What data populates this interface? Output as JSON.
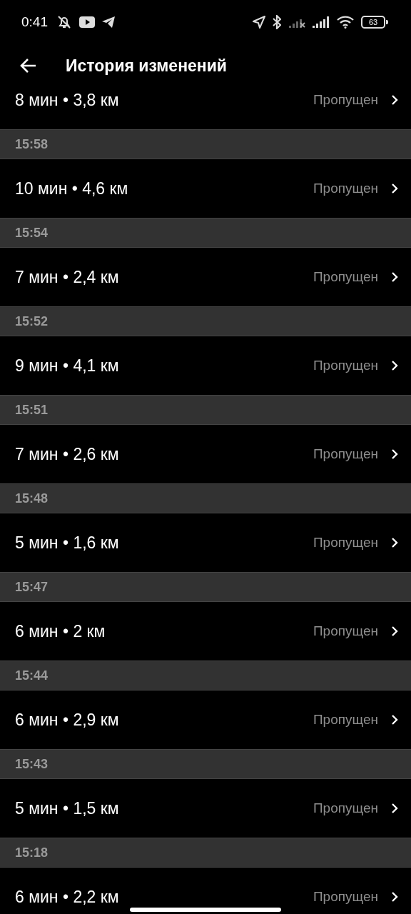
{
  "status_bar": {
    "time": "0:41",
    "battery": "63"
  },
  "app_bar": {
    "title": "История изменений"
  },
  "list": [
    {
      "kind": "row",
      "text": "8 мин • 3,8 км",
      "status": "Пропущен"
    },
    {
      "kind": "header",
      "time": "15:58"
    },
    {
      "kind": "row",
      "text": "10 мин • 4,6 км",
      "status": "Пропущен"
    },
    {
      "kind": "header",
      "time": "15:54"
    },
    {
      "kind": "row",
      "text": "7 мин • 2,4 км",
      "status": "Пропущен"
    },
    {
      "kind": "header",
      "time": "15:52"
    },
    {
      "kind": "row",
      "text": "9 мин • 4,1 км",
      "status": "Пропущен"
    },
    {
      "kind": "header",
      "time": "15:51"
    },
    {
      "kind": "row",
      "text": "7 мин • 2,6 км",
      "status": "Пропущен"
    },
    {
      "kind": "header",
      "time": "15:48"
    },
    {
      "kind": "row",
      "text": "5 мин • 1,6 км",
      "status": "Пропущен"
    },
    {
      "kind": "header",
      "time": "15:47"
    },
    {
      "kind": "row",
      "text": "6 мин • 2 км",
      "status": "Пропущен"
    },
    {
      "kind": "header",
      "time": "15:44"
    },
    {
      "kind": "row",
      "text": "6 мин • 2,9 км",
      "status": "Пропущен"
    },
    {
      "kind": "header",
      "time": "15:43"
    },
    {
      "kind": "row",
      "text": "5 мин • 1,5 км",
      "status": "Пропущен"
    },
    {
      "kind": "header",
      "time": "15:18"
    },
    {
      "kind": "row",
      "text": "6 мин • 2,2 км",
      "status": "Пропущен"
    }
  ]
}
